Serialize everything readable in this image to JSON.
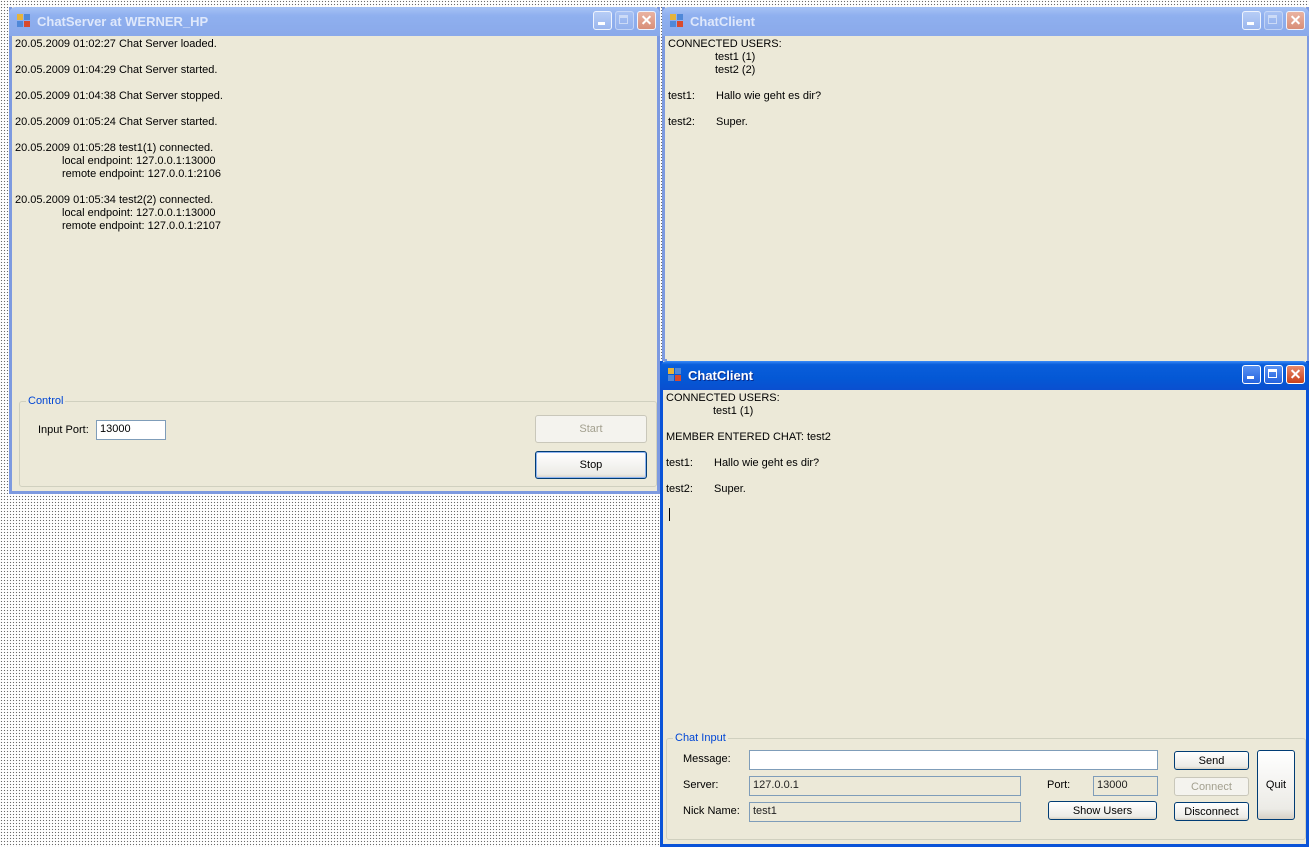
{
  "server_window": {
    "title": "ChatServer at WERNER_HP",
    "log": [
      {
        "text": "20.05.2009 01:02:27 Chat Server loaded."
      },
      {
        "text": "20.05.2009 01:04:29 Chat Server started."
      },
      {
        "text": "20.05.2009 01:04:38 Chat Server stopped."
      },
      {
        "text": "20.05.2009 01:05:24 Chat Server started."
      },
      {
        "text": "20.05.2009 01:05:28 test1(1) connected."
      },
      {
        "text": "local endpoint:  127.0.0.1:13000"
      },
      {
        "text": "remote endpoint:  127.0.0.1:2106"
      },
      {
        "text": "20.05.2009 01:05:34 test2(2) connected."
      },
      {
        "text": "local endpoint:  127.0.0.1:13000"
      },
      {
        "text": "remote endpoint:  127.0.0.1:2107"
      }
    ],
    "control": {
      "legend": "Control",
      "port_label": "Input Port:",
      "port_value": "13000",
      "start_label": "Start",
      "stop_label": "Stop"
    }
  },
  "client_back": {
    "title": "ChatClient",
    "lines": [
      "CONNECTED USERS:",
      "test1 (1)",
      "test2 (2)",
      "test1:",
      "Hallo wie geht es dir?",
      "test2:",
      "Super."
    ]
  },
  "client_front": {
    "title": "ChatClient",
    "lines": [
      "CONNECTED USERS:",
      "test1 (1)",
      "MEMBER ENTERED CHAT:  test2",
      "test1:",
      "Hallo wie geht es dir?",
      "test2:",
      "Super."
    ],
    "chat_input": {
      "legend": "Chat Input",
      "message_label": "Message:",
      "message_value": "",
      "server_label": "Server:",
      "server_value": "127.0.0.1",
      "port_label": "Port:",
      "port_value": "13000",
      "nick_label": "Nick Name:",
      "nick_value": "test1",
      "send_label": "Send",
      "connect_label": "Connect",
      "disconnect_label": "Disconnect",
      "show_users_label": "Show Users",
      "quit_label": "Quit"
    }
  },
  "icons": {
    "app_icon": "app-window-icon",
    "minimize": "minimize-icon",
    "maximize": "maximize-icon",
    "close": "close-icon"
  },
  "colors": {
    "titlebar_active": "#0a5edb",
    "titlebar_inactive": "#8fb0ef",
    "window_face": "#ece9d8",
    "group_legend": "#0046d5"
  }
}
